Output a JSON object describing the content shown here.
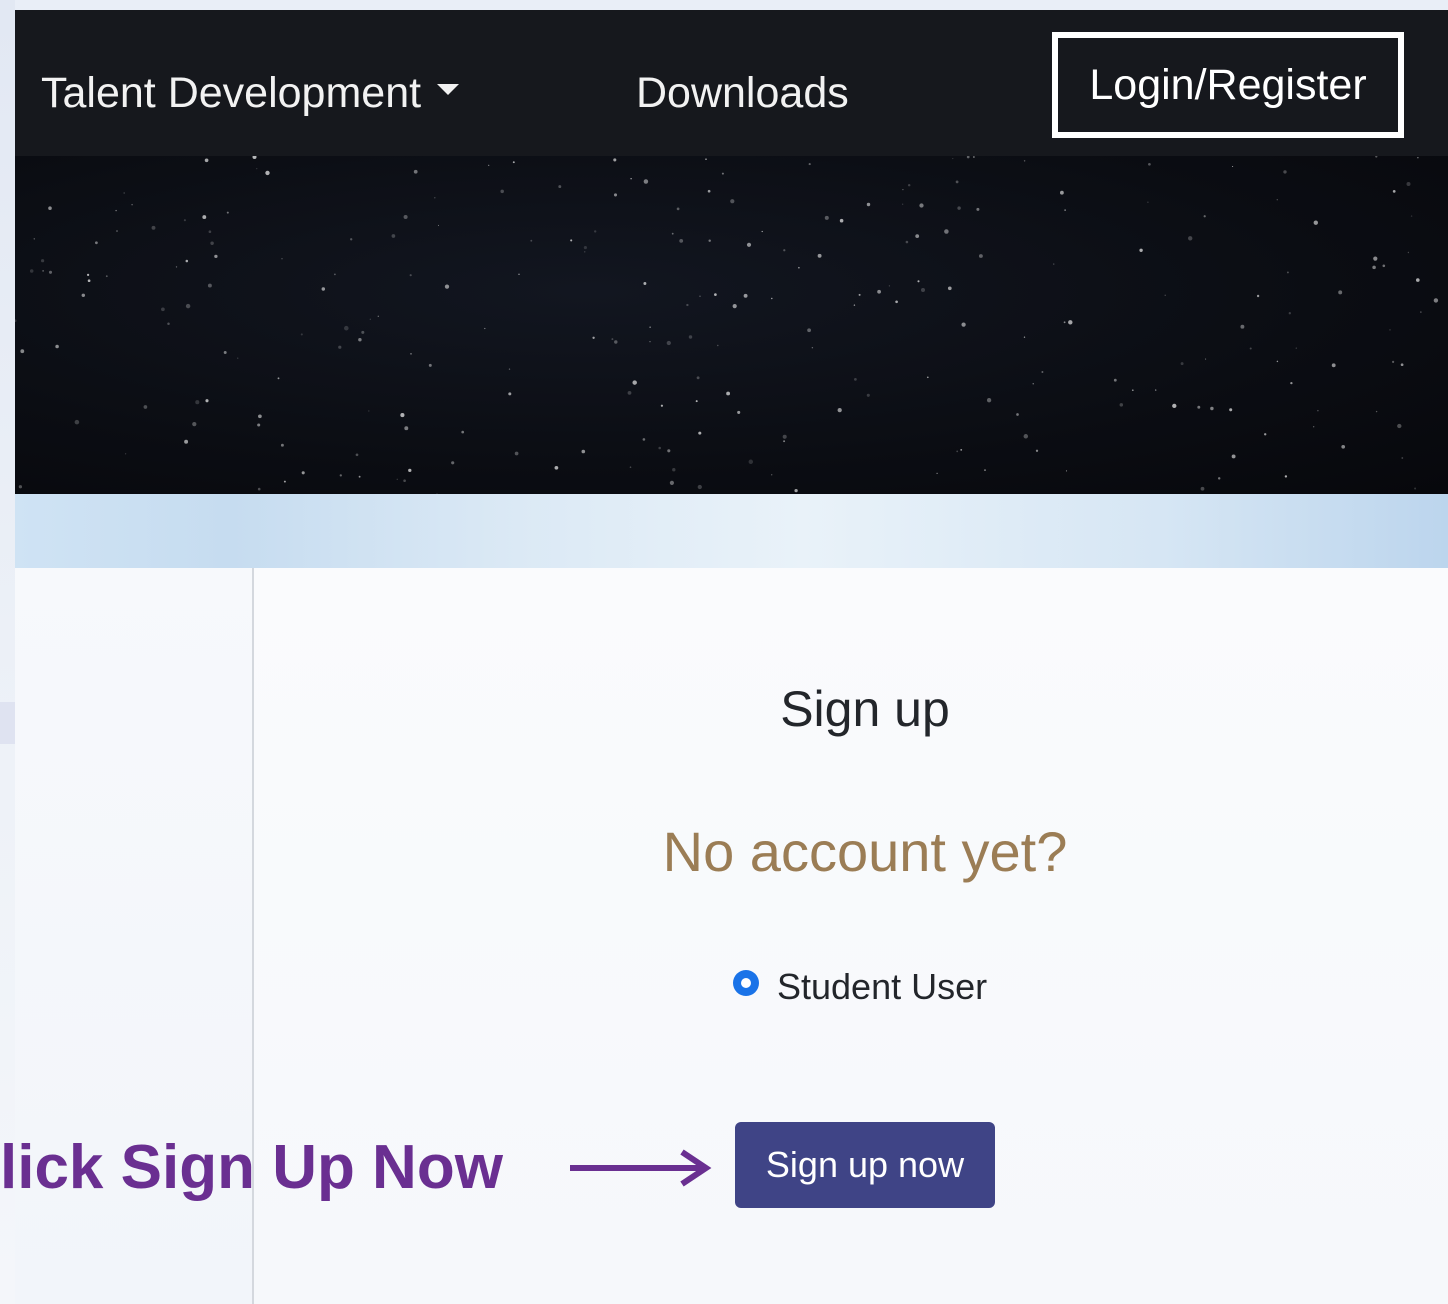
{
  "navbar": {
    "items": [
      {
        "label": "Talent Development",
        "has_dropdown": true
      },
      {
        "label": "Downloads"
      },
      {
        "label": "Login/Register",
        "highlighted": true
      }
    ]
  },
  "signup": {
    "title": "Sign up",
    "subtitle": "No account yet?",
    "radio": {
      "label": "Student User",
      "selected": true
    },
    "button_label": "Sign up now"
  },
  "annotation": {
    "text": "lick Sign Up Now",
    "color": "#6a2f91"
  },
  "colors": {
    "navbar_bg": "#16181d",
    "button_bg": "#3f4486",
    "subtitle": "#9b7d55",
    "radio": "#1a73e8"
  }
}
